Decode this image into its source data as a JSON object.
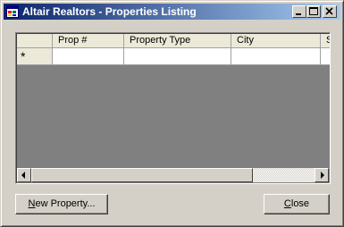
{
  "window": {
    "title": "Altair Realtors - Properties Listing",
    "icon": "app-form-icon",
    "controls": [
      "minimize-icon",
      "maximize-icon",
      "close-icon"
    ]
  },
  "grid": {
    "columns": [
      "",
      "Prop #",
      "Property Type",
      "City",
      "S"
    ],
    "new_row_marker": "*",
    "rows": []
  },
  "buttons": {
    "new_property": {
      "mnemonic": "N",
      "rest": "ew Property..."
    },
    "close": {
      "mnemonic": "C",
      "rest": "lose"
    }
  },
  "colors": {
    "titlebar_start": "#0a246a",
    "titlebar_end": "#a6caf0",
    "face": "#d4d0c8",
    "grid_background": "#808080",
    "header": "#ece9d8"
  }
}
